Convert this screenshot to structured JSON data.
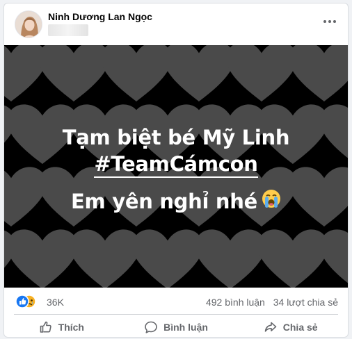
{
  "post": {
    "author": "Ninh Dương Lan Ngọc",
    "image_text": {
      "line1": "Tạm biệt bé Mỹ Linh",
      "line2": "#TeamCámcon",
      "line3": "Em yên nghỉ nhé"
    }
  },
  "stats": {
    "reactions_count": "36K",
    "comments": "492 bình luận",
    "shares": "34 lượt chia sẻ"
  },
  "actions": {
    "like": "Thích",
    "comment": "Bình luận",
    "share": "Chia sẻ"
  },
  "icons": [
    "more-icon",
    "like-reaction-icon",
    "sad-reaction-icon",
    "crying-emoji-icon",
    "like-icon",
    "comment-icon",
    "share-icon"
  ],
  "colors": {
    "like_blue": "#1877f2",
    "sad_yellow": "#f7b125",
    "text_secondary": "#65676b"
  }
}
